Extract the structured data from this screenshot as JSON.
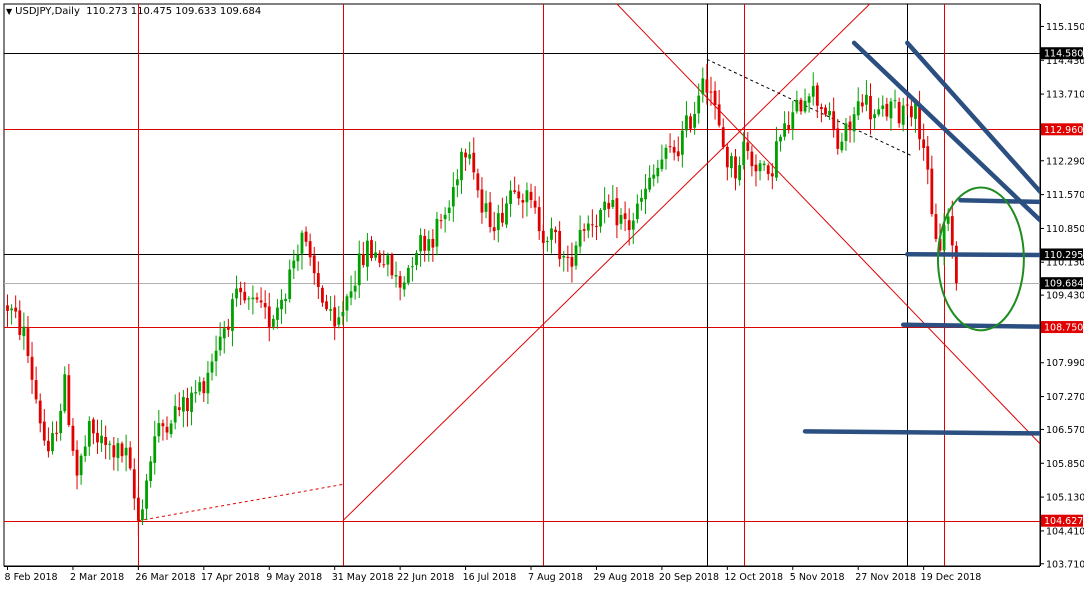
{
  "header": {
    "symbol": "USDJPY,Daily",
    "ohlc": "110.273 110.475 109.633 109.684"
  },
  "colors": {
    "background": "#ffffff",
    "bull": "#00a000",
    "bear": "#e00000",
    "grid_red": "#e00000",
    "grid_black": "#000000",
    "trend_blue": "#2a4f80",
    "circle_green": "#1e8c1e",
    "label_red": "#e00000",
    "label_black": "#000000"
  },
  "chart_data": {
    "type": "candlestick",
    "symbol": "USDJPY",
    "timeframe": "Daily",
    "ylim": [
      103.62,
      115.66
    ],
    "y_ticks": [
      "115.150",
      "114.430",
      "113.710",
      "112.290",
      "111.570",
      "110.850",
      "110.130",
      "109.430",
      "107.990",
      "107.270",
      "106.570",
      "105.850",
      "105.130",
      "104.410",
      "103.710"
    ],
    "x_ticks": [
      "8 Feb 2018",
      "2 Mar 2018",
      "26 Mar 2018",
      "17 Apr 2018",
      "9 May 2018",
      "31 May 2018",
      "22 Jun 2018",
      "16 Jul 2018",
      "7 Aug 2018",
      "29 Aug 2018",
      "20 Sep 2018",
      "12 Oct 2018",
      "5 Nov 2018",
      "27 Nov 2018",
      "19 Dec 2018"
    ],
    "price_labels": [
      {
        "text": "114.580",
        "value": 114.58,
        "style": "black"
      },
      {
        "text": "112.960",
        "value": 112.96,
        "style": "red"
      },
      {
        "text": "110.295",
        "value": 110.295,
        "style": "black"
      },
      {
        "text": "109.684",
        "value": 109.684,
        "style": "black"
      },
      {
        "text": "108.750",
        "value": 108.75,
        "style": "red"
      },
      {
        "text": "104.627",
        "value": 104.627,
        "style": "red"
      }
    ],
    "horizontal_levels": [
      {
        "value": 114.58,
        "color": "black"
      },
      {
        "value": 112.96,
        "color": "red"
      },
      {
        "value": 110.295,
        "color": "black"
      },
      {
        "value": 109.684,
        "color": "gray"
      },
      {
        "value": 108.75,
        "color": "red"
      },
      {
        "value": 104.627,
        "color": "red"
      }
    ],
    "vertical_markers": [
      {
        "bar": 32,
        "color": "red"
      },
      {
        "bar": 82,
        "color": "red"
      },
      {
        "bar": 131,
        "color": "red"
      },
      {
        "bar": 171,
        "color": "black"
      },
      {
        "bar": 180,
        "color": "red"
      },
      {
        "bar": 220,
        "color": "black"
      },
      {
        "bar": 229,
        "color": "red"
      }
    ],
    "bars": {
      "count": 233,
      "first_open": 109.2,
      "last_close": 109.684,
      "anchors": [
        [
          0,
          109.2
        ],
        [
          4,
          108.6
        ],
        [
          10,
          105.9
        ],
        [
          14,
          107.5
        ],
        [
          17,
          105.6
        ],
        [
          20,
          106.5
        ],
        [
          24,
          106.2
        ],
        [
          29,
          106.0
        ],
        [
          32,
          104.63
        ],
        [
          36,
          106.4
        ],
        [
          40,
          106.9
        ],
        [
          44,
          107.1
        ],
        [
          48,
          107.6
        ],
        [
          52,
          108.6
        ],
        [
          56,
          109.3
        ],
        [
          60,
          109.2
        ],
        [
          64,
          108.9
        ],
        [
          68,
          109.6
        ],
        [
          72,
          110.8
        ],
        [
          74,
          110.0
        ],
        [
          77,
          109.4
        ],
        [
          80,
          108.6
        ],
        [
          84,
          109.7
        ],
        [
          88,
          110.4
        ],
        [
          92,
          110.2
        ],
        [
          96,
          109.6
        ],
        [
          100,
          110.5
        ],
        [
          104,
          110.7
        ],
        [
          108,
          111.3
        ],
        [
          111,
          112.5
        ],
        [
          113,
          112.7
        ],
        [
          116,
          111.2
        ],
        [
          120,
          111.0
        ],
        [
          124,
          111.9
        ],
        [
          128,
          111.3
        ],
        [
          131,
          110.8
        ],
        [
          134,
          110.6
        ],
        [
          137,
          110.0
        ],
        [
          140,
          110.9
        ],
        [
          144,
          111.1
        ],
        [
          148,
          111.2
        ],
        [
          152,
          110.9
        ],
        [
          156,
          111.6
        ],
        [
          160,
          112.3
        ],
        [
          164,
          112.6
        ],
        [
          168,
          113.4
        ],
        [
          170,
          114.2
        ],
        [
          172,
          113.8
        ],
        [
          174,
          112.9
        ],
        [
          176,
          112.3
        ],
        [
          178,
          112.1
        ],
        [
          180,
          112.6
        ],
        [
          182,
          112.3
        ],
        [
          184,
          112.2
        ],
        [
          186,
          111.8
        ],
        [
          188,
          112.6
        ],
        [
          192,
          113.2
        ],
        [
          196,
          113.9
        ],
        [
          198,
          113.6
        ],
        [
          200,
          113.4
        ],
        [
          203,
          112.6
        ],
        [
          206,
          113.0
        ],
        [
          209,
          113.7
        ],
        [
          212,
          113.2
        ],
        [
          216,
          113.4
        ],
        [
          218,
          113.3
        ],
        [
          220,
          113.6
        ],
        [
          222,
          113.3
        ],
        [
          224,
          112.7
        ],
        [
          226,
          111.0
        ],
        [
          228,
          110.5
        ],
        [
          230,
          111.2
        ],
        [
          232,
          109.684
        ]
      ]
    },
    "trendlines": [
      {
        "color": "red",
        "from": {
          "bar": 32,
          "value": 104.627
        },
        "to": {
          "bar": 82,
          "value": 105.4
        },
        "dashed": true
      },
      {
        "color": "red",
        "from": {
          "bar": 82,
          "value": 104.627
        },
        "to": {
          "bar": 214,
          "value": 115.9
        },
        "dashed": false
      },
      {
        "color": "red",
        "from": {
          "bar": 146,
          "value": 115.9
        },
        "to": {
          "bar": 262,
          "value": 105.4
        },
        "dashed": false
      },
      {
        "color": "black",
        "from": {
          "bar": 171,
          "value": 114.45
        },
        "to": {
          "bar": 221,
          "value": 112.4
        },
        "dashed": true
      }
    ],
    "drawn_blue_lines": [
      {
        "from": {
          "bar": 207,
          "value": 114.8
        },
        "to": {
          "bar": 260,
          "value": 110.4
        }
      },
      {
        "from": {
          "bar": 220,
          "value": 114.8
        },
        "to": {
          "bar": 260,
          "value": 110.9
        }
      },
      {
        "from": {
          "bar": 233,
          "value": 111.45
        },
        "to": {
          "bar": 260,
          "value": 111.4
        }
      },
      {
        "from": {
          "bar": 220,
          "value": 110.3
        },
        "to": {
          "bar": 258,
          "value": 110.28
        }
      },
      {
        "from": {
          "bar": 219,
          "value": 108.8
        },
        "to": {
          "bar": 259,
          "value": 108.75
        }
      },
      {
        "from": {
          "bar": 195,
          "value": 106.53
        },
        "to": {
          "bar": 259,
          "value": 106.48
        }
      }
    ],
    "ellipse": {
      "center_bar": 238,
      "center_value": 110.2,
      "bar_radius": 10.5,
      "value_radius": 1.52
    },
    "grid": false,
    "legend": "none"
  }
}
